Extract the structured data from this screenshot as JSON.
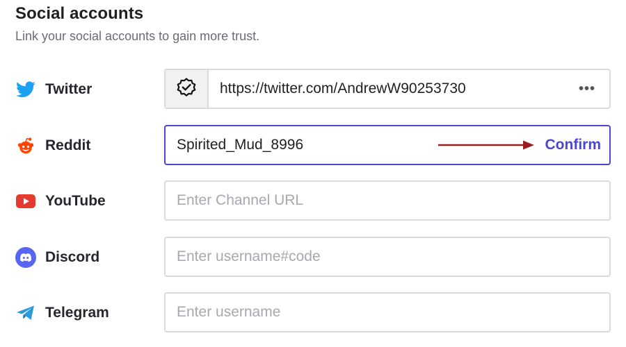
{
  "header": {
    "title": "Social accounts",
    "subtitle": "Link your social accounts to gain more trust."
  },
  "accounts": [
    {
      "name": "Twitter",
      "icon": "twitter-bird-icon",
      "color": "#1da1f2",
      "value": "https://twitter.com/AndrewW90253730",
      "verified": true,
      "more_label": "•••"
    },
    {
      "name": "Reddit",
      "icon": "reddit-alien-icon",
      "color": "#ff4500",
      "value": "Spirited_Mud_8996",
      "action_label": "Confirm",
      "arrow_color": "#9a1c1c",
      "accent": "#4b45d6"
    },
    {
      "name": "YouTube",
      "icon": "youtube-play-icon",
      "color": "#e53a2f",
      "placeholder": "Enter Channel URL"
    },
    {
      "name": "Discord",
      "icon": "discord-icon",
      "color": "#5865f2",
      "placeholder": "Enter username#code"
    },
    {
      "name": "Telegram",
      "icon": "telegram-plane-icon",
      "color": "#2a9bd8",
      "placeholder": "Enter username"
    }
  ]
}
